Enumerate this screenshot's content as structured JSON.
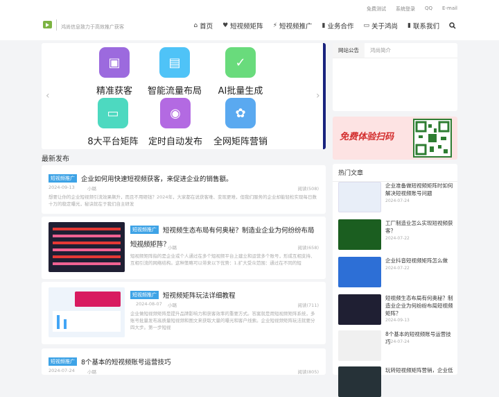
{
  "top_links": [
    "免费测试",
    "系统登录",
    "QQ",
    "E-mail"
  ],
  "slogan": "鸿尚信息致力于高效推广获客",
  "nav": [
    {
      "icon": "home-icon",
      "glyph": "⌂",
      "label": "首页"
    },
    {
      "icon": "heart-icon",
      "glyph": "♥",
      "label": "短视频矩阵"
    },
    {
      "icon": "plug-icon",
      "glyph": "⚡",
      "label": "短视频推广"
    },
    {
      "icon": "book-icon",
      "glyph": "▮",
      "label": "业务合作"
    },
    {
      "icon": "chat-icon",
      "glyph": "▭",
      "label": "关于鸿尚"
    },
    {
      "icon": "book2-icon",
      "glyph": "▮",
      "label": "联系我们"
    }
  ],
  "slider": {
    "features": [
      {
        "label": "精准获客",
        "color": "#9c6ade",
        "glyph": "▣"
      },
      {
        "label": "智能流量布局",
        "color": "#4fc3f7",
        "glyph": "▤"
      },
      {
        "label": "AI批量生成",
        "color": "#69db7c",
        "glyph": "✓"
      },
      {
        "label": "8大平台矩阵",
        "color": "#4dd9c0",
        "glyph": "▭"
      },
      {
        "label": "定时自动发布",
        "color": "#b36ae2",
        "glyph": "◉"
      },
      {
        "label": "全网矩阵营销",
        "color": "#5aa9f0",
        "glyph": "✿"
      }
    ]
  },
  "notice_tabs": [
    "网站公告",
    "鸿尚简介"
  ],
  "banner_text": "免费体验扫码",
  "section_title": "最新发布",
  "posts": [
    {
      "tag": "短视频推广",
      "title": "企业如何用快速短视频获客，来促进企业的销售额。",
      "date": "2024-09-13",
      "author": "小璐",
      "views": "阅读(508)",
      "excerpt": "想要让你的企业短视频引流效果飙升，而且不用砸钱？2024年，大家都在说获客难、变现更难，但我们服务的企业却能轻松实现每日数十万的稳定曝光，秘诀就在于我们自主研发"
    },
    {
      "tag": "短视频推广",
      "title": "短视频生态布局有何奥秘？制造业企业为何纷纷布局短视频矩阵？",
      "date": "2024-09-13",
      "author": "小璐",
      "views": "阅读(658)",
      "excerpt": "短视频矩阵指的是企业或个人通过在多个短视频平台上建立和运营多个账号，形成互相支持、互相引流的网络结构。这种策略可以带来以下优势：1.扩大受众范围：通过在不同的短"
    },
    {
      "tag": "短视频推广",
      "title": "短视频矩阵玩法详细教程",
      "date": "2024-08-07",
      "author": "小璐",
      "views": "阅读(711)",
      "excerpt": "企业做短视频矩阵是提升品牌影响力和获客效率的重要方式。答案就是用短视频矩阵系统，多账号批量发布高质量短视频和图文来获取大量的曝光和客户线索。企业短视频矩阵玩法就要分四大步。第一步短视"
    },
    {
      "tag": "短视频推广",
      "title": "8个基本的短视频账号运营技巧",
      "date": "2024-07-24",
      "author": "小璐",
      "views": "阅读(805)"
    }
  ],
  "hot_title": "热门文章",
  "hot": [
    {
      "title": "企业准备做短视频矩阵时如何解决短视频账号问题",
      "date": "2024-07-24",
      "color": "#e8eef8"
    },
    {
      "title": "工厂制造业怎么实现短视频获客？",
      "date": "2024-07-22",
      "color": "#1b5e20"
    },
    {
      "title": "企业抖音短视频矩阵怎么做",
      "date": "2024-07-22",
      "color": "#2d6fd6"
    },
    {
      "title": "短视频生态布局有何奥秘？制造业企业为何纷纷布局短视频矩阵？",
      "date": "2024-09-13",
      "color": "#1f1f33"
    },
    {
      "title": "8个基本的短视频账号运营技巧",
      "date": "2024-07-24",
      "color": "#f0f0f0"
    },
    {
      "title": "玩转短视频矩阵营销，企业低",
      "date": "",
      "color": "#263238"
    }
  ]
}
